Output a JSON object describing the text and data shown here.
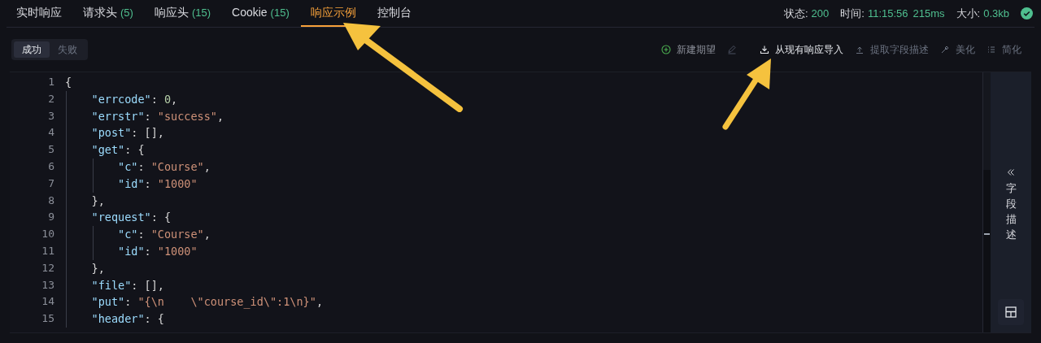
{
  "tabs": [
    {
      "label": "实时响应",
      "selected": false
    },
    {
      "label": "请求头",
      "count": "(5)",
      "selected": false
    },
    {
      "label": "响应头",
      "count": "(15)",
      "selected": false
    },
    {
      "label": "Cookie",
      "count": "(15)",
      "selected": false
    },
    {
      "label": "响应示例",
      "selected": true
    },
    {
      "label": "控制台",
      "selected": false
    }
  ],
  "status": [
    {
      "label": "状态:",
      "values": [
        "200"
      ]
    },
    {
      "label": "时间:",
      "values": [
        "11:15:56",
        "215ms"
      ]
    },
    {
      "label": "大小:",
      "values": [
        "0.3kb"
      ]
    }
  ],
  "result_toggle": [
    {
      "label": "成功",
      "selected": true
    },
    {
      "label": "失败",
      "selected": false
    }
  ],
  "actions": [
    {
      "kind": "new",
      "label": "新建期望",
      "disabled": false
    },
    {
      "kind": "edit",
      "disabled": true
    },
    {
      "kind": "import",
      "label": "从现有响应导入",
      "disabled": false
    },
    {
      "kind": "extract",
      "label": "提取字段描述",
      "disabled": true
    },
    {
      "kind": "beautify",
      "label": "美化",
      "disabled": true
    },
    {
      "kind": "simplify",
      "label": "简化",
      "disabled": true
    }
  ],
  "code_lines": [
    {
      "number": "1",
      "tokens": [
        {
          "kind": "punct",
          "text": "{"
        }
      ]
    },
    {
      "number": "2",
      "tokens": [
        {
          "kind": "key",
          "text": "    \"errcode\""
        },
        {
          "kind": "punct",
          "text": ": "
        },
        {
          "kind": "number",
          "text": "0"
        },
        {
          "kind": "punct",
          "text": ","
        }
      ]
    },
    {
      "number": "3",
      "tokens": [
        {
          "kind": "key",
          "text": "    \"errstr\""
        },
        {
          "kind": "punct",
          "text": ": "
        },
        {
          "kind": "string",
          "text": "\"success\""
        },
        {
          "kind": "punct",
          "text": ","
        }
      ]
    },
    {
      "number": "4",
      "tokens": [
        {
          "kind": "key",
          "text": "    \"post\""
        },
        {
          "kind": "punct",
          "text": ": [],"
        }
      ]
    },
    {
      "number": "5",
      "tokens": [
        {
          "kind": "key",
          "text": "    \"get\""
        },
        {
          "kind": "punct",
          "text": ": {"
        }
      ]
    },
    {
      "number": "6",
      "tokens": [
        {
          "kind": "key",
          "text": "        \"c\""
        },
        {
          "kind": "punct",
          "text": ": "
        },
        {
          "kind": "string",
          "text": "\"Course\""
        },
        {
          "kind": "punct",
          "text": ","
        }
      ]
    },
    {
      "number": "7",
      "tokens": [
        {
          "kind": "key",
          "text": "        \"id\""
        },
        {
          "kind": "punct",
          "text": ": "
        },
        {
          "kind": "string",
          "text": "\"1000\""
        }
      ]
    },
    {
      "number": "8",
      "tokens": [
        {
          "kind": "punct",
          "text": "    },"
        }
      ]
    },
    {
      "number": "9",
      "tokens": [
        {
          "kind": "key",
          "text": "    \"request\""
        },
        {
          "kind": "punct",
          "text": ": {"
        }
      ]
    },
    {
      "number": "10",
      "tokens": [
        {
          "kind": "key",
          "text": "        \"c\""
        },
        {
          "kind": "punct",
          "text": ": "
        },
        {
          "kind": "string",
          "text": "\"Course\""
        },
        {
          "kind": "punct",
          "text": ","
        }
      ]
    },
    {
      "number": "11",
      "tokens": [
        {
          "kind": "key",
          "text": "        \"id\""
        },
        {
          "kind": "punct",
          "text": ": "
        },
        {
          "kind": "string",
          "text": "\"1000\""
        }
      ]
    },
    {
      "number": "12",
      "tokens": [
        {
          "kind": "punct",
          "text": "    },"
        }
      ]
    },
    {
      "number": "13",
      "tokens": [
        {
          "kind": "key",
          "text": "    \"file\""
        },
        {
          "kind": "punct",
          "text": ": [],"
        }
      ]
    },
    {
      "number": "14",
      "tokens": [
        {
          "kind": "key",
          "text": "    \"put\""
        },
        {
          "kind": "punct",
          "text": ": "
        },
        {
          "kind": "string",
          "text": "\"{\\n    \\\"course_id\\\":1\\n}\""
        },
        {
          "kind": "punct",
          "text": ","
        }
      ]
    },
    {
      "number": "15",
      "tokens": [
        {
          "kind": "key",
          "text": "    \"header\""
        },
        {
          "kind": "punct",
          "text": ": {"
        }
      ]
    }
  ],
  "side_panel": {
    "label": "字段描述"
  }
}
